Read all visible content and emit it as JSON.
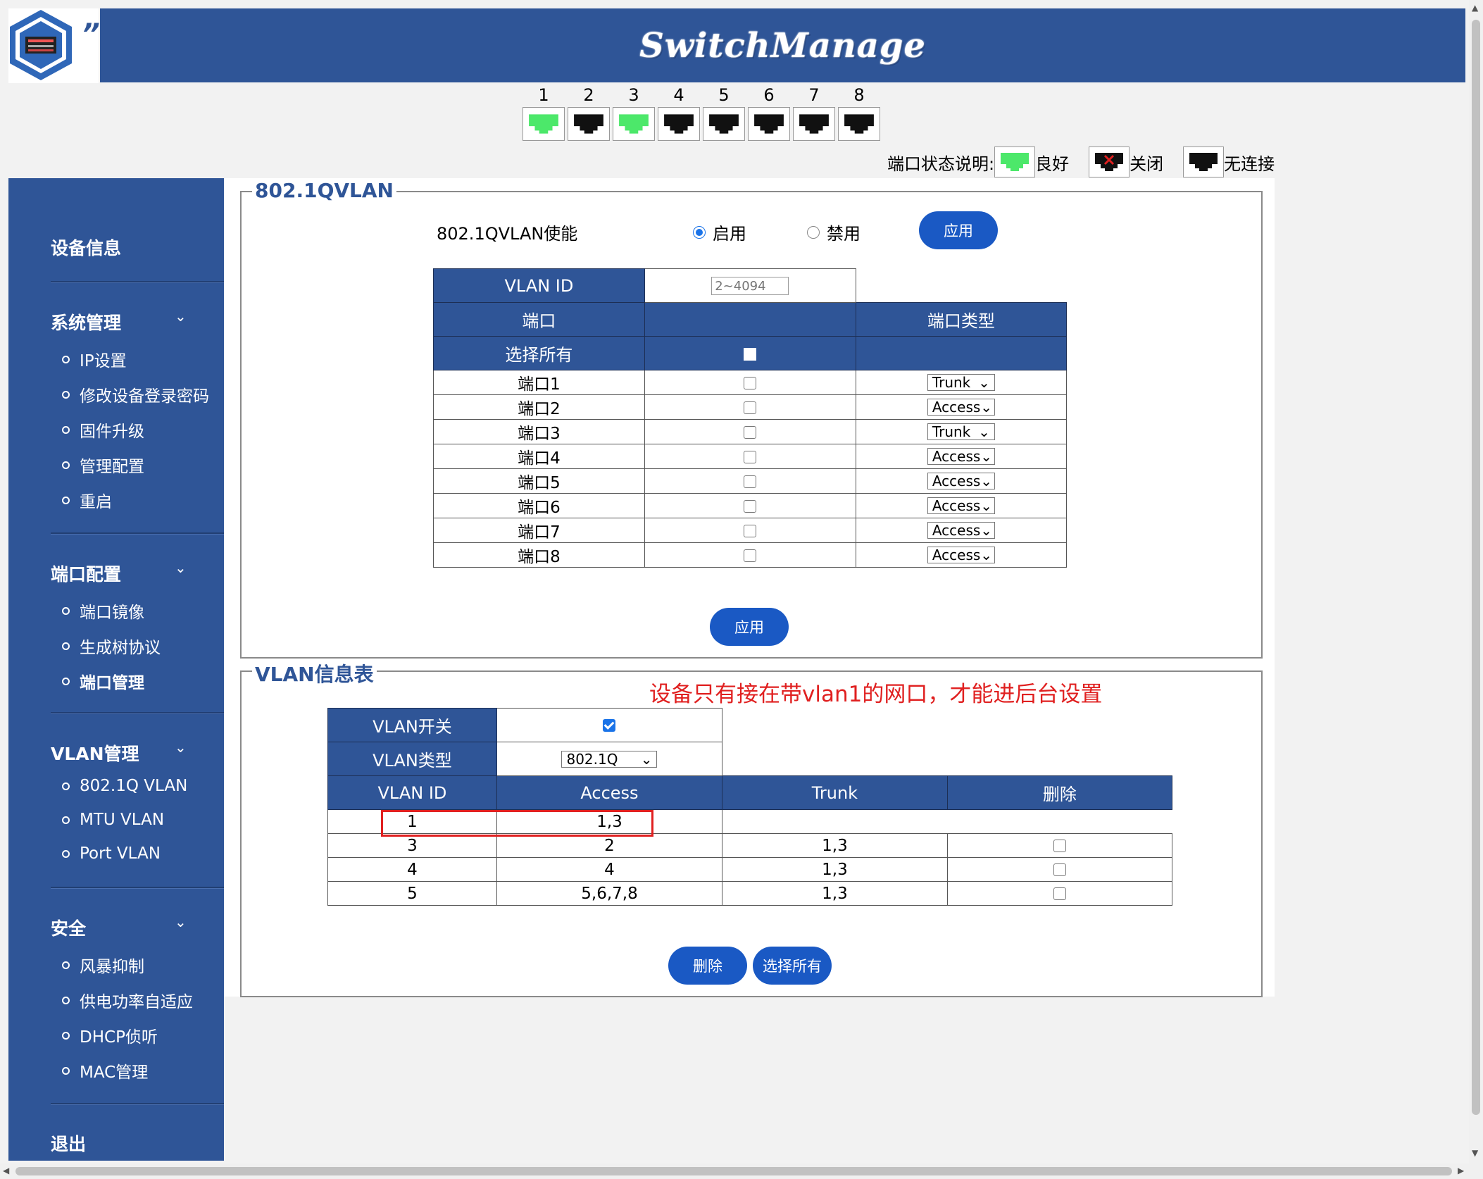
{
  "brand": "SwitchManage",
  "logo_mark": "”",
  "ports": [
    {
      "num": "1",
      "status": "good"
    },
    {
      "num": "2",
      "status": "none"
    },
    {
      "num": "3",
      "status": "good"
    },
    {
      "num": "4",
      "status": "none"
    },
    {
      "num": "5",
      "status": "none"
    },
    {
      "num": "6",
      "status": "none"
    },
    {
      "num": "7",
      "status": "none"
    },
    {
      "num": "8",
      "status": "none"
    }
  ],
  "legend": {
    "title": "端口状态说明:",
    "good": "良好",
    "closed": "关闭",
    "none": "无连接"
  },
  "colors": {
    "accent": "#2f5597",
    "good": "#4ce86a",
    "button": "#1a59c4",
    "alert": "#e02020"
  },
  "sidebar": {
    "device_info": "设备信息",
    "sys_mgmt": {
      "label": "系统管理",
      "items": [
        "IP设置",
        "修改设备登录密码",
        "固件升级",
        "管理配置",
        "重启"
      ]
    },
    "port_cfg": {
      "label": "端口配置",
      "items": [
        "端口镜像",
        "生成树协议",
        "端口管理"
      ]
    },
    "vlan_mgmt": {
      "label": "VLAN管理",
      "items": [
        "802.1Q VLAN",
        "MTU VLAN",
        "Port VLAN"
      ]
    },
    "security": {
      "label": "安全",
      "items": [
        "风暴抑制",
        "供电功率自适应",
        "DHCP侦听",
        "MAC管理"
      ]
    },
    "logout": "退出"
  },
  "qvlan": {
    "title": "802.1QVLAN",
    "enable_label": "802.1QVLAN使能",
    "enable_on": "启用",
    "enable_off": "禁用",
    "apply": "应用",
    "vlan_id_label": "VLAN ID",
    "vlan_id_placeholder": "2~4094",
    "col_port": "端口",
    "col_type": "端口类型",
    "select_all": "选择所有",
    "rows": [
      {
        "port": "端口1",
        "type": "Trunk"
      },
      {
        "port": "端口2",
        "type": "Access"
      },
      {
        "port": "端口3",
        "type": "Trunk"
      },
      {
        "port": "端口4",
        "type": "Access"
      },
      {
        "port": "端口5",
        "type": "Access"
      },
      {
        "port": "端口6",
        "type": "Access"
      },
      {
        "port": "端口7",
        "type": "Access"
      },
      {
        "port": "端口8",
        "type": "Access"
      }
    ],
    "apply2": "应用"
  },
  "vlan_info": {
    "title": "VLAN信息表",
    "note": "设备只有接在带vlan1的网口，才能进后台设置",
    "switch_label": "VLAN开关",
    "type_label": "VLAN类型",
    "type_value": "802.1Q",
    "headers": [
      "VLAN ID",
      "Access",
      "Trunk",
      "删除"
    ],
    "rows": [
      {
        "id": "1",
        "access": "1,3",
        "trunk": ""
      },
      {
        "id": "3",
        "access": "2",
        "trunk": "1,3"
      },
      {
        "id": "4",
        "access": "4",
        "trunk": "1,3"
      },
      {
        "id": "5",
        "access": "5,6,7,8",
        "trunk": "1,3"
      }
    ],
    "delete_btn": "删除",
    "select_all_btn": "选择所有"
  }
}
